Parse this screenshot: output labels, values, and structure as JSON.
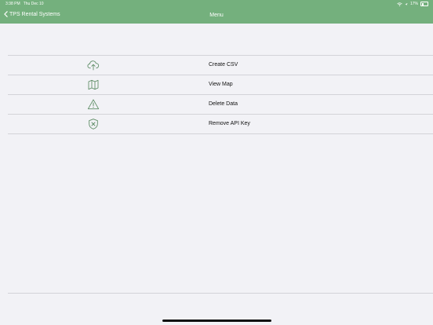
{
  "status": {
    "time": "3:38 PM",
    "date": "Thu Dec 10",
    "battery": "17%"
  },
  "nav": {
    "back_label": "TPS Rental Systems",
    "title": "Menu"
  },
  "menu": {
    "items": [
      {
        "label": "Create CSV",
        "icon": "cloud-upload-icon"
      },
      {
        "label": "View Map",
        "icon": "map-icon"
      },
      {
        "label": "Delete Data",
        "icon": "warning-icon"
      },
      {
        "label": "Remove API Key",
        "icon": "shield-x-icon"
      }
    ]
  },
  "colors": {
    "accent": "#74b07d",
    "icon": "#5d8c65",
    "background": "#f2f2f6"
  }
}
